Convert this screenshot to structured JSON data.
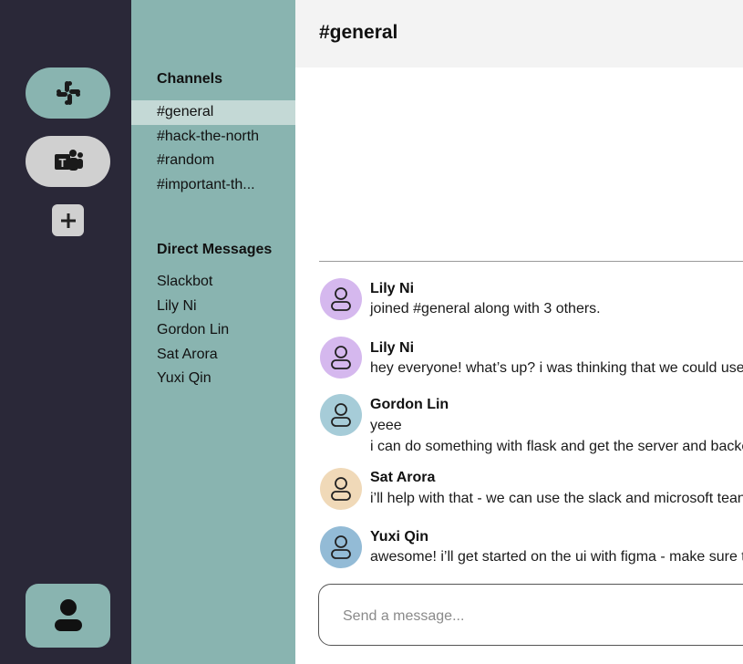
{
  "rail": {
    "workspaces": [
      {
        "icon": "slack-icon",
        "color": "#89b4b0"
      },
      {
        "icon": "teams-icon",
        "color": "#d0d0d0"
      }
    ],
    "add_icon": "plus-icon",
    "profile_icon": "user-icon"
  },
  "sidebar": {
    "channels_title": "Channels",
    "channels": [
      {
        "label": "#general",
        "active": true
      },
      {
        "label": "#hack-the-north"
      },
      {
        "label": "#random"
      },
      {
        "label": "#important-th..."
      }
    ],
    "dms_title": "Direct Messages",
    "dms": [
      {
        "label": "Slackbot"
      },
      {
        "label": "Lily Ni"
      },
      {
        "label": "Gordon Lin"
      },
      {
        "label": "Sat Arora"
      },
      {
        "label": "Yuxi Qin"
      }
    ]
  },
  "main": {
    "title": "#general",
    "messages": [
      {
        "name": "Lily Ni",
        "avatar_color": "#d5b8ee",
        "lines": [
          "joined #general along with 3 others."
        ]
      },
      {
        "name": "Lily Ni",
        "avatar_color": "#d5b8ee",
        "lines": [
          "hey everyone! what’s up? i was thinking that we could use"
        ]
      },
      {
        "name": "Gordon Lin",
        "avatar_color": "#a6ccd8",
        "lines": [
          "yeee",
          "i can do something with flask and get the server and backe"
        ]
      },
      {
        "name": "Sat Arora",
        "avatar_color": "#f0d9b8",
        "lines": [
          "i’ll help with that - we can use the slack and microsoft tean"
        ]
      },
      {
        "name": "Yuxi Qin",
        "avatar_color": "#93bbd6",
        "lines": [
          "awesome! i’ll get started on the ui with figma - make sure t"
        ]
      }
    ],
    "composer_placeholder": "Send a message..."
  }
}
